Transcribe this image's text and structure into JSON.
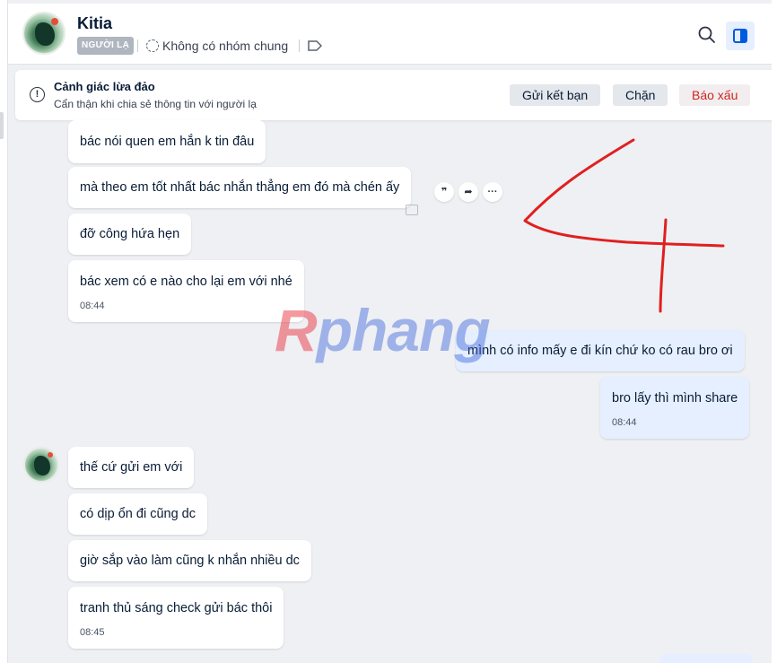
{
  "contact": {
    "name": "Kitia",
    "stranger_badge": "NGƯỜI LẠ",
    "group_status": "Không có nhóm chung"
  },
  "warning": {
    "title": "Cảnh giác lừa đảo",
    "subtitle": "Cẩn thận khi chia sẻ thông tin với người lạ",
    "add_friend": "Gửi kết bạn",
    "block": "Chặn",
    "report": "Báo xấu"
  },
  "messages": [
    {
      "from": "them",
      "text": "bác nói quen em hắn k tin đâu"
    },
    {
      "from": "them",
      "text": "mà theo em tốt nhất bác nhắn thẳng em đó mà chén ấy"
    },
    {
      "from": "them",
      "text": "đỡ công hứa hẹn"
    },
    {
      "from": "them",
      "text": "bác xem có e nào cho lại em với nhé",
      "time": "08:44"
    },
    {
      "from": "me",
      "text": "mình có info mấy e đi kín chứ ko có rau bro ơi"
    },
    {
      "from": "me",
      "text": "bro lấy thì mình share",
      "time": "08:44"
    },
    {
      "from": "them",
      "text": "thế cứ gửi em với"
    },
    {
      "from": "them",
      "text": "có dịp ổn đi cũng dc"
    },
    {
      "from": "them",
      "text": "giờ sắp vào làm cũng k nhắn nhiều dc"
    },
    {
      "from": "them",
      "text": "tranh thủ sáng check gửi bác thôi",
      "time": "08:45"
    }
  ],
  "watermark": {
    "first": "R",
    "rest": "phang"
  },
  "icons": {
    "search": "search-icon",
    "panel": "panel-toggle-icon",
    "group": "group-icon",
    "tag": "tag-icon",
    "warning": "alert-circle-icon",
    "quote": "quote-icon",
    "forward": "forward-icon",
    "more": "more-icon",
    "like": "like-icon"
  },
  "colors": {
    "accent": "#005ae0",
    "my_bubble": "#e5efff",
    "report": "#d0251c",
    "scribble": "#e02020"
  }
}
